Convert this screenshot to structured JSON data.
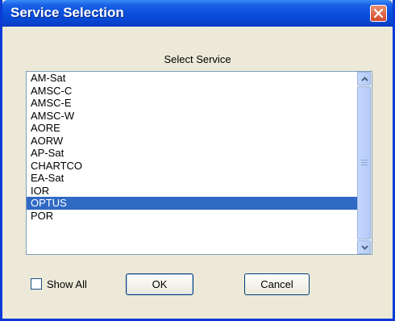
{
  "window": {
    "title": "Service Selection"
  },
  "caption": "Select Service",
  "list": {
    "items": [
      "AM-Sat",
      "AMSC-C",
      "AMSC-E",
      "AMSC-W",
      "AORE",
      "AORW",
      "AP-Sat",
      "CHARTCO",
      "EA-Sat",
      "IOR",
      "OPTUS",
      "POR"
    ],
    "selected_index": 10
  },
  "show_all": {
    "label": "Show All",
    "checked": false
  },
  "buttons": {
    "ok": "OK",
    "cancel": "Cancel"
  },
  "colors": {
    "titlebar": "#0a4fdc",
    "selection": "#316ac5",
    "dialog_bg": "#ece9d8"
  },
  "icons": {
    "close": "close-icon",
    "scroll_up": "chevron-up-icon",
    "scroll_down": "chevron-down-icon"
  }
}
